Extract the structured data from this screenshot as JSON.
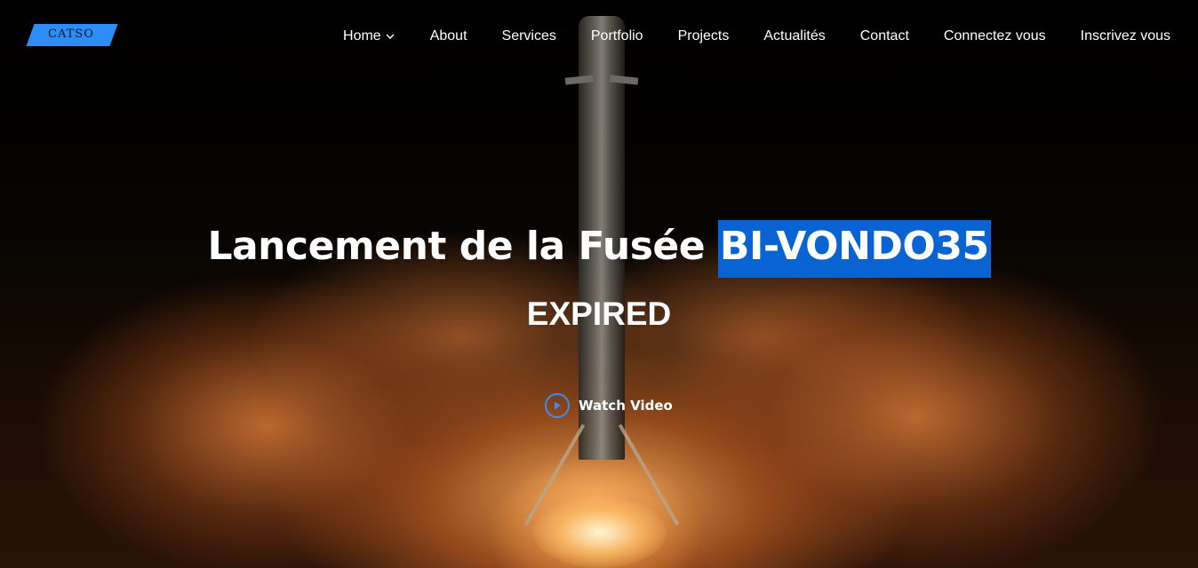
{
  "brand": {
    "logo_text": "CATSO",
    "accent_color": "#2e8cf5"
  },
  "nav": {
    "items": [
      {
        "label": "Home",
        "icon": "chevron-down-icon"
      },
      {
        "label": "About"
      },
      {
        "label": "Services"
      },
      {
        "label": "Portfolio"
      },
      {
        "label": "Projects"
      },
      {
        "label": "Actualités"
      },
      {
        "label": "Contact"
      },
      {
        "label": "Connectez vous"
      },
      {
        "label": "Inscrivez vous"
      }
    ]
  },
  "hero": {
    "title_prefix": "Lancement de la Fusée",
    "title_highlight": "BI-VONDO35",
    "highlight_color": "#0a63d2",
    "status": "EXPIRED",
    "watch_video_label": "Watch Video",
    "watch_icon": "play-icon"
  }
}
